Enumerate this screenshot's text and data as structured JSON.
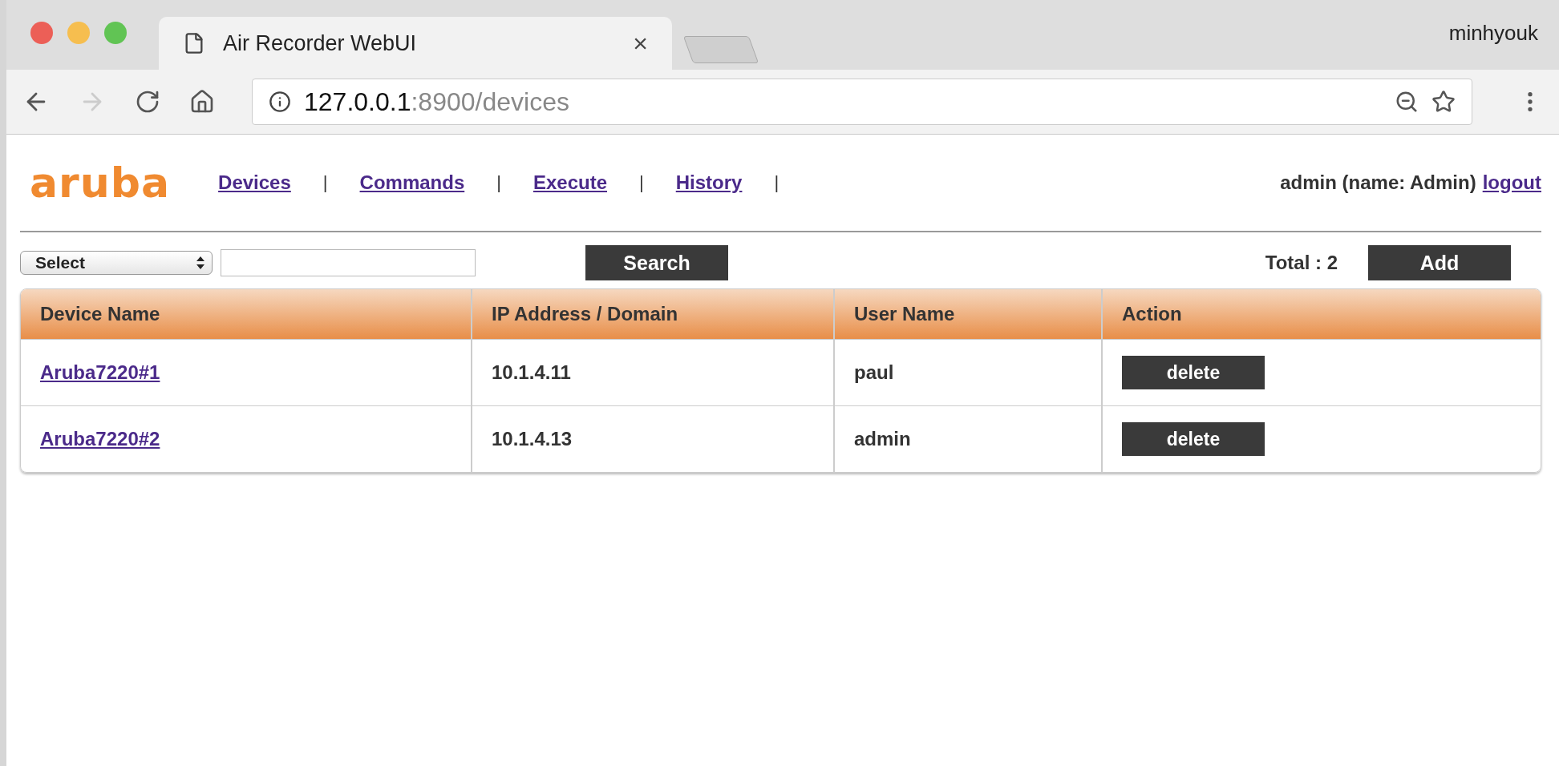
{
  "browser": {
    "tab_title": "Air Recorder WebUI",
    "tab_close": "×",
    "profile": "minhyouk",
    "url_host": "127.0.0.1",
    "url_rest": ":8900/devices"
  },
  "header": {
    "logo": "aruba",
    "nav": [
      {
        "label": "Devices"
      },
      {
        "label": "Commands"
      },
      {
        "label": "Execute"
      },
      {
        "label": "History"
      }
    ],
    "separator": "|",
    "user": "admin (name: Admin)",
    "logout": "logout"
  },
  "toolbar": {
    "select": "Select",
    "search_button": "Search",
    "total": "Total : 2",
    "add_button": "Add"
  },
  "table": {
    "columns": [
      "Device Name",
      "IP Address / Domain",
      "User Name",
      "Action"
    ],
    "rows": [
      {
        "device": "Aruba7220#1",
        "ip": "10.1.4.11",
        "user": "paul",
        "action": "delete"
      },
      {
        "device": "Aruba7220#2",
        "ip": "10.1.4.13",
        "user": "admin",
        "action": "delete"
      }
    ]
  }
}
